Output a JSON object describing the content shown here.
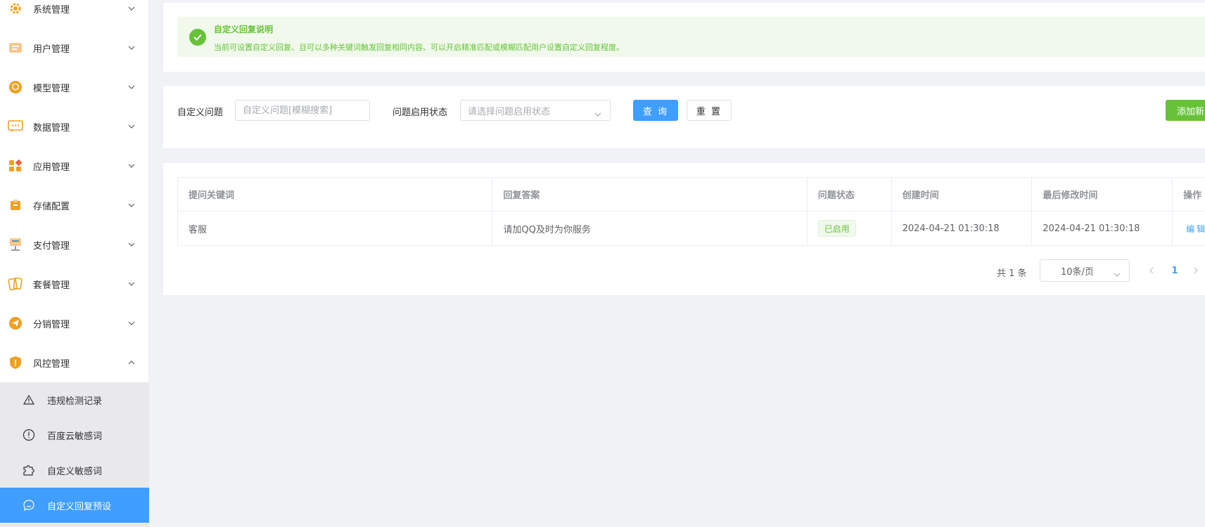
{
  "sidebar": {
    "items": [
      {
        "label": "系统管理",
        "icon": "gear-icon"
      },
      {
        "label": "用户管理",
        "icon": "user-card-icon"
      },
      {
        "label": "模型管理",
        "icon": "cube-icon"
      },
      {
        "label": "数据管理",
        "icon": "chat-data-icon"
      },
      {
        "label": "应用管理",
        "icon": "apps-icon"
      },
      {
        "label": "存储配置",
        "icon": "storage-icon"
      },
      {
        "label": "支付管理",
        "icon": "payment-icon"
      },
      {
        "label": "套餐管理",
        "icon": "package-cards-icon"
      },
      {
        "label": "分销管理",
        "icon": "send-icon"
      },
      {
        "label": "风控管理",
        "icon": "shield-icon"
      }
    ],
    "submenu": [
      {
        "label": "违规检测记录",
        "icon": "warning-icon"
      },
      {
        "label": "百度云敏感词",
        "icon": "exclamation-circle-icon"
      },
      {
        "label": "自定义敏感词",
        "icon": "puzzle-icon"
      },
      {
        "label": "自定义回复预设",
        "icon": "chat-bubble-icon"
      }
    ]
  },
  "notice": {
    "title": "自定义回复说明",
    "description": "当前可设置自定义回复、且可以多种关键词触发回复相同内容、可以开启精准匹配或模糊匹配用户设置自定义回复程度。"
  },
  "filter": {
    "question_label": "自定义问题",
    "question_placeholder": "自定义问题[模糊搜索]",
    "status_label": "问题启用状态",
    "status_placeholder": "请选择问题启用状态",
    "query_button": "查 询",
    "reset_button": "重 置",
    "add_button": "添加新"
  },
  "table": {
    "headers": [
      "提问关键词",
      "回复答案",
      "问题状态",
      "创建时间",
      "最后修改时间",
      "操作"
    ],
    "rows": [
      {
        "keyword": "客服",
        "answer": "请加QQ及时为你服务",
        "status": "已启用",
        "created": "2024-04-21 01:30:18",
        "modified": "2024-04-21 01:30:18",
        "action": "编辑"
      }
    ]
  },
  "pagination": {
    "total": "共 1 条",
    "page_size": "10条/页",
    "current_page": "1"
  },
  "colors": {
    "primary": "#409eff",
    "success": "#67c23a",
    "menu_icon": "#f0a020"
  }
}
